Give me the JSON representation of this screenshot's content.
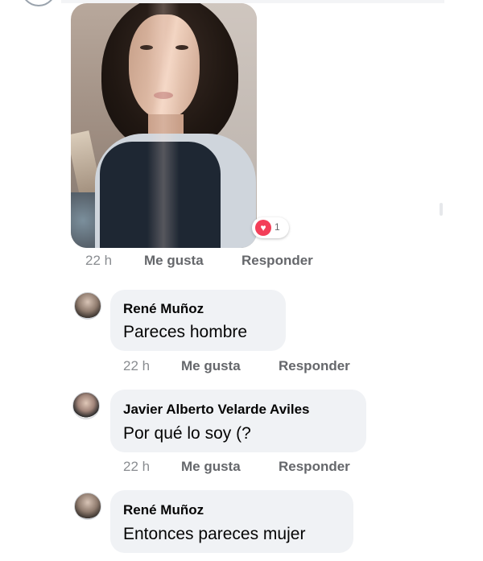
{
  "post": {
    "reaction": {
      "icon": "heart-icon",
      "count": "1"
    },
    "meta": {
      "time": "22 h",
      "like": "Me gusta",
      "reply": "Responder"
    }
  },
  "comments": [
    {
      "author": "René Muñoz",
      "text": "Pareces hombre",
      "time": "22 h",
      "like": "Me gusta",
      "reply": "Responder"
    },
    {
      "author": "Javier Alberto Velarde Aviles",
      "text": "Por qué lo soy (?",
      "time": "22 h",
      "like": "Me gusta",
      "reply": "Responder"
    },
    {
      "author": "René Muñoz",
      "text": "Entonces pareces mujer"
    }
  ],
  "colors": {
    "bubble": "#f0f2f5",
    "meta_text": "#65676b",
    "heart": "#f33e58"
  }
}
